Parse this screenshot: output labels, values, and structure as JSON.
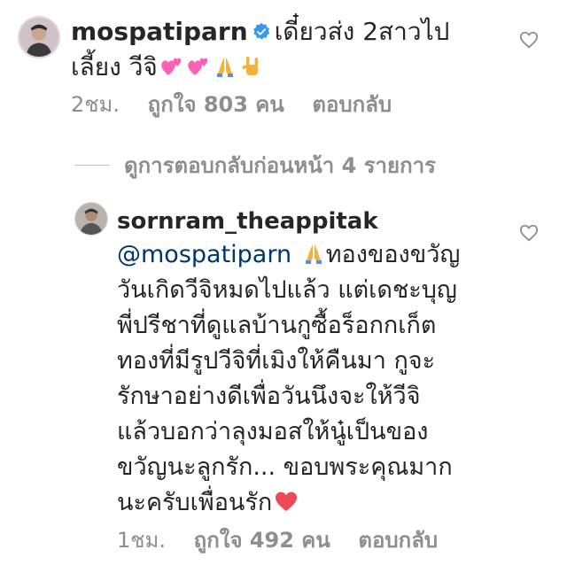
{
  "top_comment": {
    "username": "mospatiparn",
    "text_line1": "เดี๋ยวส่ง 2สาวไป",
    "text_line2": "เลี้ยง วีจิ",
    "time": "2ชม.",
    "likes": "ถูกใจ 803 คน",
    "reply_label": "ตอบกลับ",
    "emojis": [
      "pink-hearts-icon",
      "pink-hearts-icon",
      "folded-hands-icon",
      "rock-on-hand-icon"
    ]
  },
  "view_previous_replies": "ดูการตอบกลับก่อนหน้า 4 รายการ",
  "reply_comment": {
    "username": "sornram_theappitak",
    "mention": "@mospatiparn",
    "lines": [
      "ทองของขวัญ",
      "วันเกิดวีจิหมดไปแล้ว แต่เดชะบุญ",
      "พี่ปรีชาที่ดูแลบ้านกูซื้อร็อกกเก็ต",
      "ทองที่มีรูปวีจิที่เมิงให้คืนมา กูจะ",
      "รักษาอย่างดีเพื่อวันนึงจะให้วีจิ",
      "แล้วบอกว่าลุงมอสให้นู๋เป็นของ",
      "ขวัญนะลูกรัก... ขอบพระคุณมาก",
      "นะครับเพื่อนรัก"
    ],
    "time": "1ชม.",
    "likes": "ถูกใจ 492 คน",
    "reply_label": "ตอบกลับ"
  },
  "colors": {
    "text": "#262626",
    "secondary": "#8e8e8e",
    "mention": "#00376b",
    "verified": "#3897f0",
    "heart_red": "#ed4956",
    "heart_pink": "#ff5fb4"
  }
}
